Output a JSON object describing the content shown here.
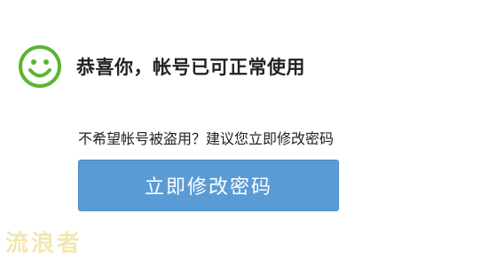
{
  "success": {
    "icon": "smiley-face-icon",
    "icon_color": "#5cb531",
    "message": "恭喜你，帐号已可正常使用"
  },
  "suggestion": {
    "text": "不希望帐号被盗用？建议您立即修改密码"
  },
  "actions": {
    "change_password_label": "立即修改密码",
    "button_color": "#5b9bd5"
  },
  "watermark": {
    "text": "流浪者",
    "color": "#f1e6b0"
  }
}
